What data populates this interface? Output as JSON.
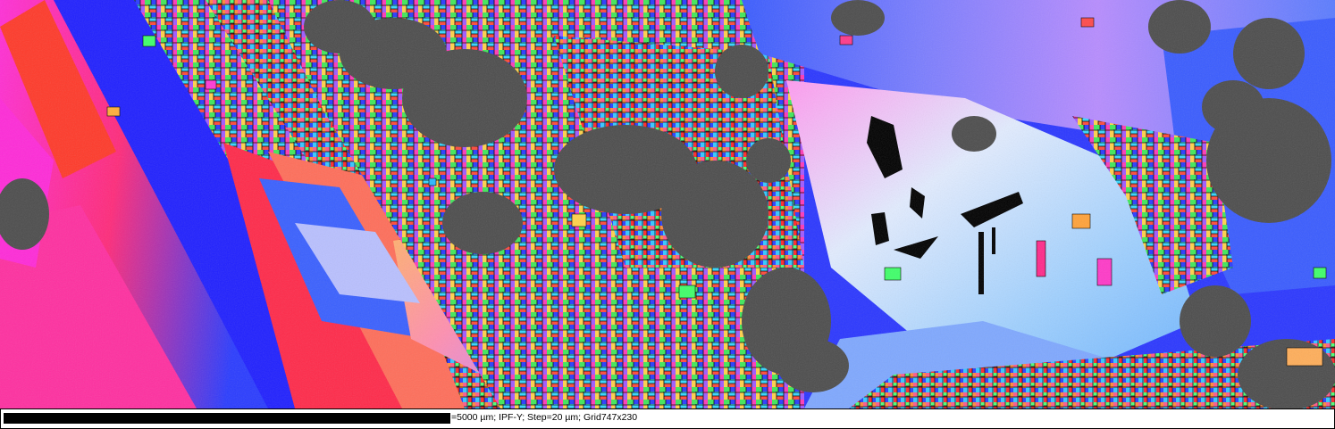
{
  "image": {
    "kind": "EBSD inverse pole figure orientation map",
    "phases_shown": [
      "indexed grains (IPF colored)",
      "non-indexed regions (grey band contrast)",
      "zero solutions (black)"
    ]
  },
  "scale_bar": {
    "label": "=5000 µm; IPF-Y; Step=20 µm; Grid747x230"
  },
  "colors": {
    "background": "#ffffff",
    "text": "#000000",
    "non_indexed": "#4a4a4a",
    "ipf_red": "#ff2a2a",
    "ipf_green": "#3cff5a",
    "ipf_blue": "#2030ff",
    "ipf_magenta": "#ff2ad0",
    "ipf_cyan": "#40e0ff",
    "ipf_orange": "#ff8a40",
    "ipf_pale": "#dfe8ff"
  }
}
